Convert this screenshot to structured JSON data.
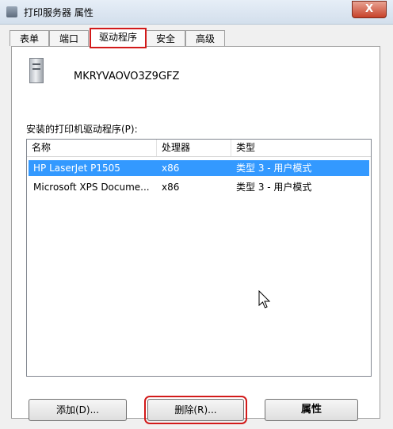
{
  "window": {
    "title": "打印服务器 属性",
    "close_glyph": "X"
  },
  "tabs": [
    {
      "label": "表单",
      "active": false
    },
    {
      "label": "端口",
      "active": false
    },
    {
      "label": "驱动程序",
      "active": true
    },
    {
      "label": "安全",
      "active": false
    },
    {
      "label": "高级",
      "active": false
    }
  ],
  "server": {
    "name": "MKRYVAOVO3Z9GFZ",
    "icon": "server-icon"
  },
  "drivers_list": {
    "label": "安装的打印机驱动程序(P):",
    "columns": [
      "名称",
      "处理器",
      "类型"
    ],
    "rows": [
      {
        "name": "HP LaserJet P1505",
        "processor": "x86",
        "type": "类型 3 - 用户模式",
        "selected": true
      },
      {
        "name": "Microsoft XPS Docume...",
        "processor": "x86",
        "type": "类型 3 - 用户模式",
        "selected": false
      }
    ]
  },
  "buttons": {
    "add": "添加(D)...",
    "remove": "删除(R)...",
    "properties": "属性"
  },
  "colors": {
    "selection": "#3399ff",
    "highlight": "#d21a1a"
  }
}
